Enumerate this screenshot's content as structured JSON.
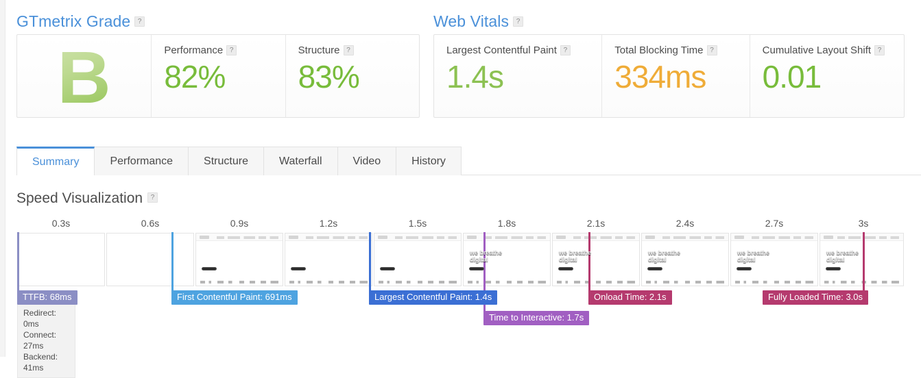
{
  "gtmetrix_grade": {
    "heading": "GTmetrix Grade",
    "help": "?",
    "grade": "B",
    "metrics": [
      {
        "label": "Performance",
        "help": "?",
        "value": "82%",
        "color": "#78bc3b"
      },
      {
        "label": "Structure",
        "help": "?",
        "value": "83%",
        "color": "#78bc3b"
      }
    ]
  },
  "web_vitals": {
    "heading": "Web Vitals",
    "help": "?",
    "metrics": [
      {
        "label": "Largest Contentful Paint",
        "help": "?",
        "value": "1.4s",
        "color": "#8cc152"
      },
      {
        "label": "Total Blocking Time",
        "help": "?",
        "value": "334ms",
        "color": "#efac38"
      },
      {
        "label": "Cumulative Layout Shift",
        "help": "?",
        "value": "0.01",
        "color": "#78bc3b"
      }
    ]
  },
  "tabs": [
    {
      "label": "Summary",
      "active": true
    },
    {
      "label": "Performance",
      "active": false
    },
    {
      "label": "Structure",
      "active": false
    },
    {
      "label": "Waterfall",
      "active": false
    },
    {
      "label": "Video",
      "active": false
    },
    {
      "label": "History",
      "active": false
    }
  ],
  "speed_visualization": {
    "heading": "Speed Visualization",
    "help": "?",
    "ticks": [
      "0.3s",
      "0.6s",
      "0.9s",
      "1.2s",
      "1.5s",
      "1.8s",
      "2.1s",
      "2.4s",
      "2.7s",
      "3s"
    ],
    "frames": [
      {
        "state": "blank",
        "overlay": ""
      },
      {
        "state": "blank",
        "overlay": ""
      },
      {
        "state": "hero",
        "overlay": ""
      },
      {
        "state": "hero",
        "overlay": ""
      },
      {
        "state": "hero",
        "overlay": ""
      },
      {
        "state": "hero",
        "overlay": "we breathe\ndigital"
      },
      {
        "state": "hero",
        "overlay": "we breathe\ndigital"
      },
      {
        "state": "hero",
        "overlay": "we breathe\ndigital"
      },
      {
        "state": "hero",
        "overlay": "we breathe\ndigital"
      },
      {
        "state": "hero",
        "overlay": "we breathe\ndigital"
      }
    ],
    "markers": [
      {
        "name": "ttfb",
        "label": "TTFB: 68ms",
        "color": "#8b8ec4",
        "line_color": "#8b8ec4"
      },
      {
        "name": "first-contentful-paint",
        "label": "First Contentful Paint: 691ms",
        "color": "#4ea3e0",
        "line_color": "#4ea3e0"
      },
      {
        "name": "largest-contentful-paint",
        "label": "Largest Contentful Paint: 1.4s",
        "color": "#3b6fd4",
        "line_color": "#3b6fd4"
      },
      {
        "name": "time-to-interactive",
        "label": "Time to Interactive: 1.7s",
        "color": "#a15fc2",
        "line_color": "#a15fc2"
      },
      {
        "name": "onload-time",
        "label": "Onload Time: 2.1s",
        "color": "#b53a6e",
        "line_color": "#b53a6e"
      },
      {
        "name": "fully-loaded-time",
        "label": "Fully Loaded Time: 3.0s",
        "color": "#b53a6e",
        "line_color": "#b53a6e"
      }
    ],
    "ttfb_breakdown": "Redirect: 0ms\nConnect: 27ms\nBackend: 41ms"
  }
}
